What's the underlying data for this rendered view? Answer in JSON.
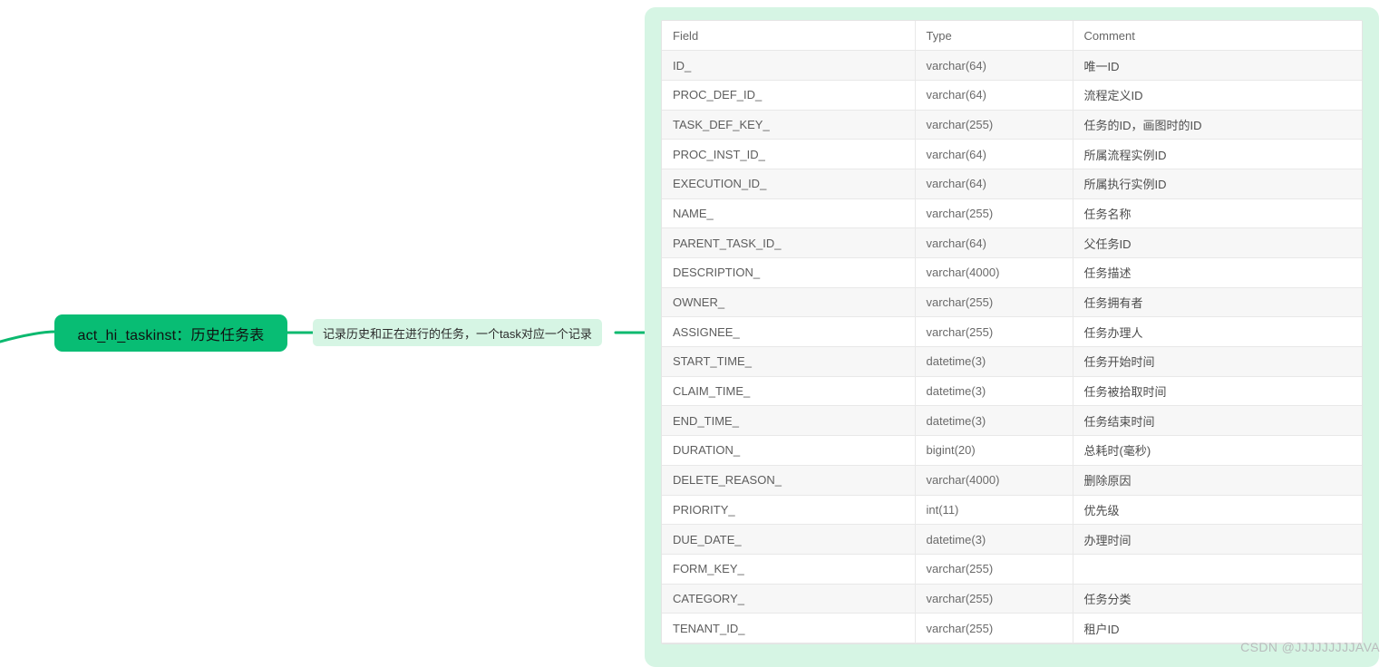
{
  "mindmap": {
    "root_node": {
      "label": "act_hi_taskinst：历史任务表",
      "color": "#08bd74"
    },
    "description_node": {
      "label": "记录历史和正在进行的任务，一个task对应一个记录",
      "color": "#d6f5e4"
    },
    "branch_color": "#0cb96f"
  },
  "panel": {
    "background_color": "#d6f5e4"
  },
  "table": {
    "columns": [
      "Field",
      "Type",
      "Comment"
    ],
    "rows": [
      {
        "field": "ID_",
        "type": "varchar(64)",
        "comment": "唯一ID"
      },
      {
        "field": "PROC_DEF_ID_",
        "type": "varchar(64)",
        "comment": "流程定义ID"
      },
      {
        "field": "TASK_DEF_KEY_",
        "type": "varchar(255)",
        "comment": "任务的ID，画图时的ID"
      },
      {
        "field": "PROC_INST_ID_",
        "type": "varchar(64)",
        "comment": "所属流程实例ID"
      },
      {
        "field": "EXECUTION_ID_",
        "type": "varchar(64)",
        "comment": "所属执行实例ID"
      },
      {
        "field": "NAME_",
        "type": "varchar(255)",
        "comment": "任务名称"
      },
      {
        "field": "PARENT_TASK_ID_",
        "type": "varchar(64)",
        "comment": "父任务ID"
      },
      {
        "field": "DESCRIPTION_",
        "type": "varchar(4000)",
        "comment": "任务描述"
      },
      {
        "field": "OWNER_",
        "type": "varchar(255)",
        "comment": "任务拥有者"
      },
      {
        "field": "ASSIGNEE_",
        "type": "varchar(255)",
        "comment": "任务办理人"
      },
      {
        "field": "START_TIME_",
        "type": "datetime(3)",
        "comment": "任务开始时间"
      },
      {
        "field": "CLAIM_TIME_",
        "type": "datetime(3)",
        "comment": "任务被拾取时间"
      },
      {
        "field": "END_TIME_",
        "type": "datetime(3)",
        "comment": "任务结束时间"
      },
      {
        "field": "DURATION_",
        "type": "bigint(20)",
        "comment": "总耗时(毫秒)"
      },
      {
        "field": "DELETE_REASON_",
        "type": "varchar(4000)",
        "comment": "删除原因"
      },
      {
        "field": "PRIORITY_",
        "type": "int(11)",
        "comment": "优先级"
      },
      {
        "field": "DUE_DATE_",
        "type": "datetime(3)",
        "comment": "办理时间"
      },
      {
        "field": "FORM_KEY_",
        "type": "varchar(255)",
        "comment": ""
      },
      {
        "field": "CATEGORY_",
        "type": "varchar(255)",
        "comment": "任务分类"
      },
      {
        "field": "TENANT_ID_",
        "type": "varchar(255)",
        "comment": "租户ID"
      }
    ]
  },
  "watermark": {
    "text": "CSDN @JJJJJJJJJAVA"
  }
}
